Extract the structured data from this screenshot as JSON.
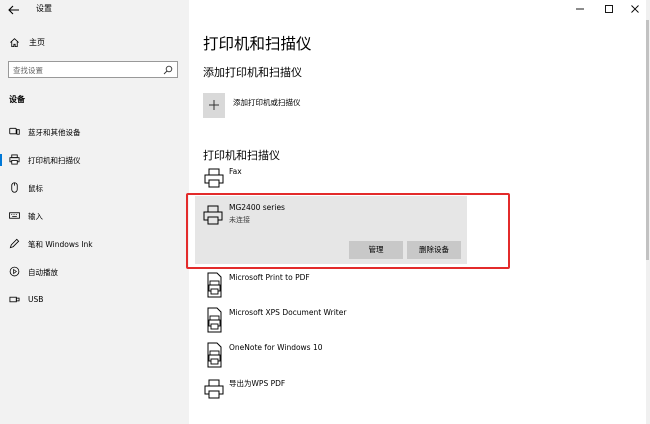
{
  "window": {
    "title": "设置"
  },
  "sidebar": {
    "home_label": "主页",
    "search_placeholder": "查找设置",
    "section_label": "设备",
    "items": [
      {
        "label": "蓝牙和其他设备",
        "icon": "bluetooth-icon"
      },
      {
        "label": "打印机和扫描仪",
        "icon": "printer-icon",
        "active": true
      },
      {
        "label": "鼠标",
        "icon": "mouse-icon"
      },
      {
        "label": "输入",
        "icon": "keyboard-icon"
      },
      {
        "label": "笔和 Windows Ink",
        "icon": "pen-icon"
      },
      {
        "label": "自动播放",
        "icon": "autoplay-icon"
      },
      {
        "label": "USB",
        "icon": "usb-icon"
      }
    ]
  },
  "main": {
    "title": "打印机和扫描仪",
    "add_section_title": "添加打印机和扫描仪",
    "add_label": "添加打印机或扫描仪",
    "list_title": "打印机和扫描仪",
    "devices": [
      {
        "name": "Fax"
      },
      {
        "name": "MG2400 series",
        "status": "未连接",
        "selected": true
      },
      {
        "name": "Microsoft Print to PDF"
      },
      {
        "name": "Microsoft XPS Document Writer"
      },
      {
        "name": "OneNote for Windows 10"
      },
      {
        "name": "导出为WPS PDF"
      }
    ],
    "manage_label": "管理",
    "remove_label": "删除设备"
  },
  "colors": {
    "accent": "#0078d7",
    "highlight": "#e32b2b",
    "sidebar_bg": "#f2f2f2",
    "selected_bg": "#e6e6e6"
  }
}
